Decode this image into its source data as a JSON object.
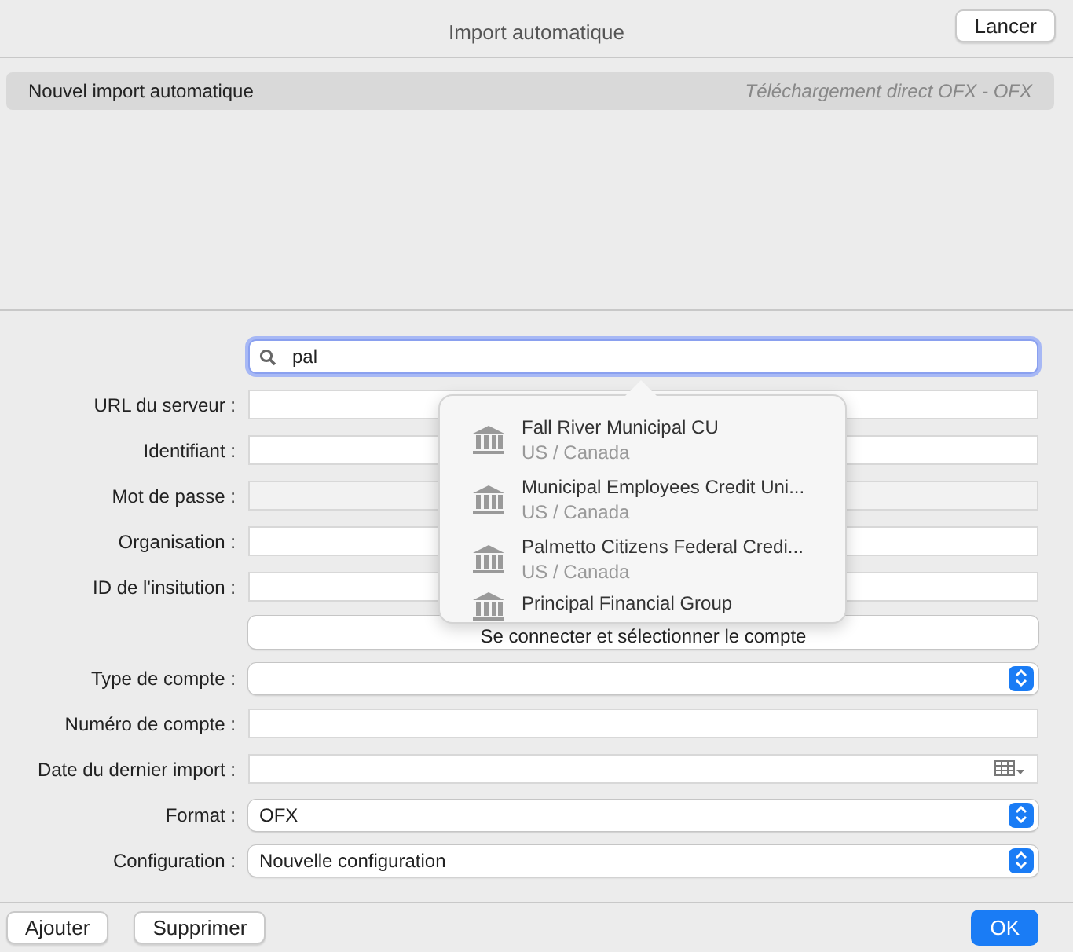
{
  "window": {
    "title": "Import automatique",
    "action_button": "Lancer"
  },
  "imports": [
    {
      "name": "Nouvel import automatique",
      "type": "Téléchargement direct OFX - OFX",
      "selected": true
    }
  ],
  "search": {
    "value": "pal"
  },
  "fields": [
    {
      "kind": "text",
      "label": "URL du serveur :",
      "disabled": false
    },
    {
      "kind": "text",
      "label": "Identifiant :",
      "disabled": false
    },
    {
      "kind": "text",
      "label": "Mot de passe :",
      "disabled": true
    },
    {
      "kind": "text",
      "label": "Organisation :",
      "disabled": false
    },
    {
      "kind": "text",
      "label": "ID de l'insitution :",
      "disabled": false
    },
    {
      "kind": "button",
      "label": "Se connecter et sélectionner le compte",
      "disabled": false
    },
    {
      "kind": "select",
      "label": "Type de compte :",
      "disabled": false
    },
    {
      "kind": "text",
      "label": "Numéro de compte :",
      "disabled": false
    },
    {
      "kind": "date",
      "label": "Date du dernier import :",
      "disabled": false
    },
    {
      "kind": "select",
      "label": "Format :",
      "value": "OFX",
      "disabled": false
    },
    {
      "kind": "select",
      "label": "Configuration :",
      "value": "Nouvelle configuration",
      "disabled": false
    }
  ],
  "suggestions": [
    {
      "name": "Fall River Municipal CU",
      "region": "US / Canada"
    },
    {
      "name": "Municipal Employees Credit Uni...",
      "region": "US / Canada"
    },
    {
      "name": "Palmetto Citizens Federal Credi...",
      "region": "US / Canada"
    },
    {
      "name": "Principal Financial Group"
    }
  ],
  "footer": {
    "left_buttons": [
      "Ajouter",
      "Supprimer"
    ],
    "ok_button": "OK"
  }
}
